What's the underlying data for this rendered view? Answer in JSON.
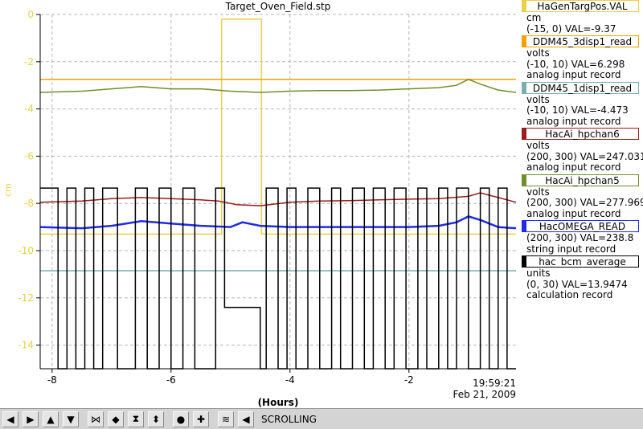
{
  "chart_data": {
    "type": "line",
    "title": "Target_Oven_Field.stp",
    "ylabel": "cm",
    "xlabel": "(Hours)",
    "xlim": [
      -8.2,
      -0.2
    ],
    "ylim": [
      -15,
      0
    ],
    "xticks": [
      -8,
      -6,
      -4,
      -2
    ],
    "yticks": [
      0,
      -2,
      -4,
      -6,
      -8,
      -10,
      -12,
      -14
    ],
    "grid": true,
    "timestamp": {
      "time": "19:59:21",
      "date": "Feb 21, 2009"
    },
    "series": [
      {
        "name": "HaGenTargPos.VAL",
        "color": "#e8d04a",
        "x": [
          -8.2,
          -5.15,
          -5.15,
          -4.48,
          -4.48,
          -0.2
        ],
        "y": [
          -9.3,
          -9.3,
          -0.2,
          -0.2,
          -9.3,
          -9.3
        ]
      },
      {
        "name": "DDM45_3disp1_read",
        "color": "#f5a000",
        "x": [
          -8.2,
          -0.2
        ],
        "y": [
          -2.75,
          -2.75
        ]
      },
      {
        "name": "DDM45_1disp1_read",
        "color": "#7aaeb0",
        "x": [
          -8.2,
          -0.2
        ],
        "y": [
          -10.85,
          -10.85
        ]
      },
      {
        "name": "HacAi_hpchan6",
        "color": "#9b1c1c",
        "x": [
          -8.2,
          -7.5,
          -7.0,
          -6.5,
          -6.0,
          -5.5,
          -5.2,
          -4.9,
          -4.5,
          -4.0,
          -3.5,
          -3.0,
          -2.5,
          -2.0,
          -1.5,
          -1.0,
          -0.8,
          -0.5,
          -0.2
        ],
        "y": [
          -7.95,
          -7.9,
          -7.8,
          -7.75,
          -7.8,
          -7.85,
          -7.9,
          -8.05,
          -8.1,
          -7.95,
          -7.9,
          -7.88,
          -7.85,
          -7.82,
          -7.8,
          -7.7,
          -7.55,
          -7.75,
          -7.95
        ]
      },
      {
        "name": "HacAi_hpchan5",
        "color": "#6f8f2a",
        "x": [
          -8.2,
          -7.5,
          -7.0,
          -6.5,
          -6.0,
          -5.5,
          -5.0,
          -4.5,
          -4.0,
          -3.5,
          -3.0,
          -2.5,
          -2.0,
          -1.5,
          -1.2,
          -1.0,
          -0.8,
          -0.5,
          -0.2
        ],
        "y": [
          -3.3,
          -3.25,
          -3.15,
          -3.05,
          -3.15,
          -3.15,
          -3.25,
          -3.3,
          -3.25,
          -3.22,
          -3.22,
          -3.2,
          -3.15,
          -3.1,
          -3.0,
          -2.75,
          -2.95,
          -3.2,
          -3.3
        ]
      },
      {
        "name": "HacOMEGA_READ",
        "color": "#1f2be8",
        "x": [
          -8.2,
          -7.5,
          -7.0,
          -6.5,
          -6.0,
          -5.5,
          -5.0,
          -4.8,
          -4.5,
          -4.0,
          -3.5,
          -3.0,
          -2.5,
          -2.0,
          -1.5,
          -1.2,
          -1.0,
          -0.8,
          -0.5,
          -0.2
        ],
        "y": [
          -9.0,
          -9.05,
          -8.95,
          -8.75,
          -8.85,
          -8.95,
          -9.0,
          -8.8,
          -8.95,
          -9.0,
          -9.0,
          -9.0,
          -9.0,
          -9.0,
          -8.95,
          -8.8,
          -8.55,
          -8.7,
          -9.0,
          -9.05
        ]
      },
      {
        "name": "hac_bcm_average",
        "color": "#000000",
        "x": [
          -8.2,
          -7.9,
          -7.9,
          -7.75,
          -7.75,
          -7.6,
          -7.6,
          -7.45,
          -7.45,
          -7.3,
          -7.3,
          -7.15,
          -7.15,
          -6.9,
          -6.9,
          -6.6,
          -6.6,
          -6.4,
          -6.4,
          -6.2,
          -6.2,
          -6.0,
          -6.0,
          -5.8,
          -5.8,
          -5.6,
          -5.6,
          -5.25,
          -5.25,
          -5.1,
          -5.1,
          -4.5,
          -4.5,
          -4.4,
          -4.4,
          -4.2,
          -4.2,
          -4.05,
          -4.05,
          -3.9,
          -3.9,
          -3.7,
          -3.7,
          -3.5,
          -3.5,
          -3.3,
          -3.3,
          -3.15,
          -3.15,
          -2.95,
          -2.95,
          -2.75,
          -2.75,
          -2.6,
          -2.6,
          -2.4,
          -2.4,
          -2.25,
          -2.25,
          -2.05,
          -2.05,
          -1.85,
          -1.85,
          -1.7,
          -1.7,
          -1.5,
          -1.5,
          -1.35,
          -1.35,
          -1.2,
          -1.2,
          -1.0,
          -1.0,
          -0.8,
          -0.8,
          -0.65,
          -0.65,
          -0.5,
          -0.5,
          -0.35,
          -0.35,
          -0.2
        ],
        "y": [
          -7.35,
          -7.35,
          -15,
          -15,
          -7.35,
          -7.35,
          -15,
          -15,
          -7.35,
          -7.35,
          -15,
          -15,
          -7.35,
          -7.35,
          -15,
          -15,
          -7.35,
          -7.35,
          -15,
          -15,
          -7.35,
          -7.35,
          -15,
          -15,
          -7.35,
          -7.35,
          -15,
          -15,
          -7.35,
          -7.35,
          -12.4,
          -12.4,
          -15,
          -15,
          -7.35,
          -7.35,
          -15,
          -15,
          -7.35,
          -7.35,
          -15,
          -15,
          -7.35,
          -7.35,
          -15,
          -15,
          -7.35,
          -7.35,
          -15,
          -15,
          -7.35,
          -7.35,
          -15,
          -15,
          -7.35,
          -7.35,
          -15,
          -15,
          -7.35,
          -7.35,
          -15,
          -15,
          -7.35,
          -7.35,
          -15,
          -15,
          -7.35,
          -7.35,
          -15,
          -15,
          -7.35,
          -7.35,
          -15,
          -15,
          -7.35,
          -7.35,
          -15,
          -15,
          -7.35,
          -7.35,
          -15,
          -15
        ]
      }
    ]
  },
  "legend": [
    {
      "name": "HaGenTargPos.VAL",
      "color": "#e8d04a",
      "lines": [
        "cm",
        "(-15, 0) VAL=-9.37"
      ]
    },
    {
      "name": "DDM45_3disp1_read",
      "color": "#f5a000",
      "lines": [
        "volts",
        "(-10, 10) VAL=6.298",
        "analog input record"
      ]
    },
    {
      "name": "DDM45_1disp1_read",
      "color": "#7aaeb0",
      "lines": [
        "volts",
        "(-10, 10) VAL=-4.473",
        "analog input record"
      ]
    },
    {
      "name": "HacAi_hpchan6",
      "color": "#9b1c1c",
      "lines": [
        "volts",
        "(200, 300) VAL=247.031",
        "analog input record"
      ]
    },
    {
      "name": "HacAi_hpchan5",
      "color": "#6f8f2a",
      "lines": [
        "volts",
        "(200, 300) VAL=277.969",
        "analog input record"
      ]
    },
    {
      "name": "HacOMEGA_READ",
      "color": "#1f2be8",
      "lines": [
        "(200, 300) VAL=238.8",
        "string input record"
      ]
    },
    {
      "name": "hac_bcm_average",
      "color": "#000000",
      "lines": [
        "units",
        "(0, 30) VAL=13.9474",
        "calculation record"
      ]
    }
  ],
  "toolbar": {
    "buttons": [
      {
        "name": "scroll-left-icon",
        "glyph": "◀"
      },
      {
        "name": "scroll-right-icon",
        "glyph": "▶"
      },
      {
        "name": "scroll-up-icon",
        "glyph": "▲"
      },
      {
        "name": "scroll-down-icon",
        "glyph": "▼"
      },
      {
        "name": "zoom-in-x-icon",
        "glyph": "⋈"
      },
      {
        "name": "zoom-out-x-icon",
        "glyph": "◆"
      },
      {
        "name": "zoom-in-y-icon",
        "glyph": "⧗"
      },
      {
        "name": "zoom-out-y-icon",
        "glyph": "⬍"
      },
      {
        "name": "autoscale-icon",
        "glyph": "●"
      },
      {
        "name": "add-icon",
        "glyph": "✚"
      },
      {
        "name": "style-icon",
        "glyph": "≋"
      },
      {
        "name": "scroll-to-end-icon",
        "glyph": "◀"
      }
    ],
    "mode_label": "SCROLLING"
  }
}
